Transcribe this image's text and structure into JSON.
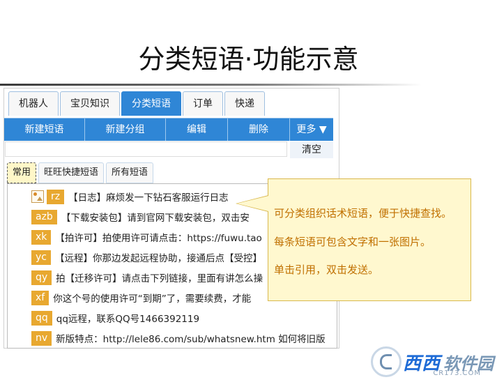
{
  "title": "分类短语·功能示意",
  "tabs": [
    "机器人",
    "宝贝知识",
    "分类短语",
    "订单",
    "快递"
  ],
  "active_tab": "分类短语",
  "toolbar": {
    "new_phrase": "新建短语",
    "new_group": "新建分组",
    "edit": "编辑",
    "delete": "删除",
    "more": "更多 ▼"
  },
  "search": {
    "value": "",
    "clear_label": "清空"
  },
  "subtabs": [
    "常用",
    "旺旺快捷短语",
    "所有短语"
  ],
  "active_subtab": "常用",
  "phrases": [
    {
      "code": "rz",
      "text": "【日志】麻烦发一下钻石客服运行日志",
      "has_image": true
    },
    {
      "code": "azb",
      "text": "【下载安装包】请到官网下载安装包，双击安"
    },
    {
      "code": "xk",
      "text": "【拍许可】拍使用许可请点击：https://fuwu.tao"
    },
    {
      "code": "yc",
      "text": "【远程】你那边发起远程协助，接通后点【受控】"
    },
    {
      "code": "qy",
      "text": "拍【迁移许可】请点击下列链接，里面有讲怎么操"
    },
    {
      "code": "xf",
      "text": "你这个号的使用许可“到期”了，需要续费，才能"
    },
    {
      "code": "qq",
      "text": "qq远程，联系QQ号1466392119"
    },
    {
      "code": "nv",
      "text": "新版特点：http://lele86.com/sub/whatsnew.htm  如何将旧版"
    }
  ],
  "callout": {
    "line1": "可分类组织话术短语，便于快捷查找。",
    "line2": "每条短语可包含文字和一张图片。",
    "line3": "单击引用，双击发送。"
  },
  "logo": {
    "text1": "西西",
    "text2": "软件园",
    "sub": "CR173.COM"
  },
  "colors": {
    "accent": "#2f86d6",
    "code_badge": "#e8a830",
    "callout_bg": "#fff8cf",
    "callout_text": "#c07000"
  }
}
